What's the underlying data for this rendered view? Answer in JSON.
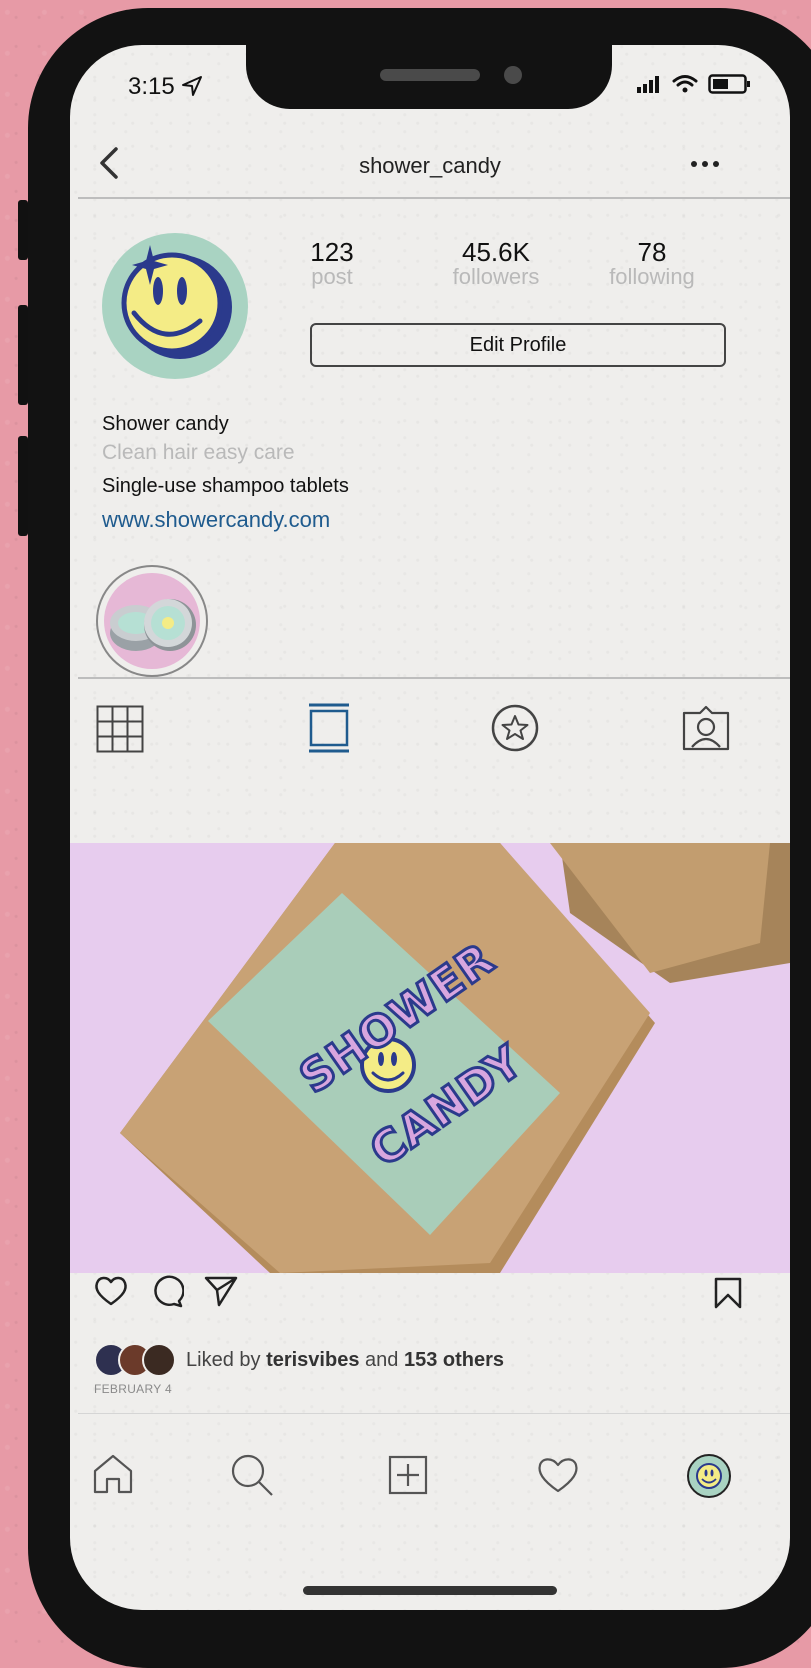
{
  "status_bar": {
    "time": "3:15"
  },
  "header": {
    "username": "shower_candy"
  },
  "stats": [
    {
      "number": "123",
      "label": "post"
    },
    {
      "number": "45.6K",
      "label": "followers"
    },
    {
      "number": "78",
      "label": "following"
    }
  ],
  "edit_profile_label": "Edit Profile",
  "bio": {
    "name": "Shower candy",
    "category": "Clean hair easy care",
    "description": "Single-use shampoo tablets",
    "website": "www.showercandy.com"
  },
  "post": {
    "liked_by_prefix": "Liked by",
    "liked_by_user": "terisvibes",
    "liked_by_and": "and",
    "liked_by_others": "153 others",
    "date": "FEBRUARY 4",
    "sticker_line1": "SHOWER",
    "sticker_line2": "CANDY"
  },
  "colors": {
    "background": "#e79aa6",
    "screen": "#efeeec",
    "accent_blue": "#1f5b8e",
    "mint": "#a9d3c2",
    "smiley_yellow": "#f4ec86",
    "post_pink": "#e7ccee"
  },
  "icons": {
    "back": "chevron-left",
    "more": "ellipsis",
    "tabs": [
      "grid",
      "reels",
      "star",
      "tagged"
    ],
    "actions": [
      "heart",
      "comment",
      "send",
      "bookmark"
    ],
    "nav": [
      "home",
      "search",
      "add",
      "heart",
      "profile"
    ]
  }
}
